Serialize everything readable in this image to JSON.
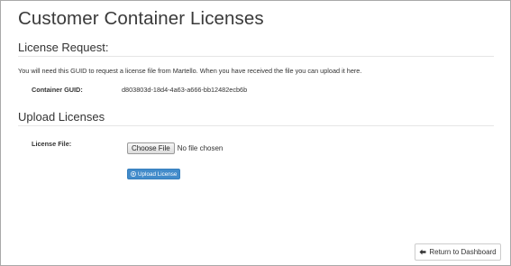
{
  "page": {
    "title": "Customer Container Licenses"
  },
  "license_request": {
    "heading": "License Request:",
    "intro": "You will need this GUID to request a license file from Martello. When you have received the file you can upload it here.",
    "guid_label": "Container GUID:",
    "guid_value": "d803803d-18d4-4a63-a666-bb12482ecb6b"
  },
  "upload_licenses": {
    "heading": "Upload Licenses",
    "file_label": "License File:",
    "choose_file_label": "Choose File",
    "file_status": "No file chosen",
    "upload_button_label": "Upload License",
    "upload_icon": "upload-circle-icon"
  },
  "footer": {
    "return_button_label": "Return to Dashboard",
    "return_icon": "arrow-left-icon"
  },
  "colors": {
    "primary_button": "#428bca",
    "text": "#333333",
    "rule": "#e5e5e5"
  }
}
